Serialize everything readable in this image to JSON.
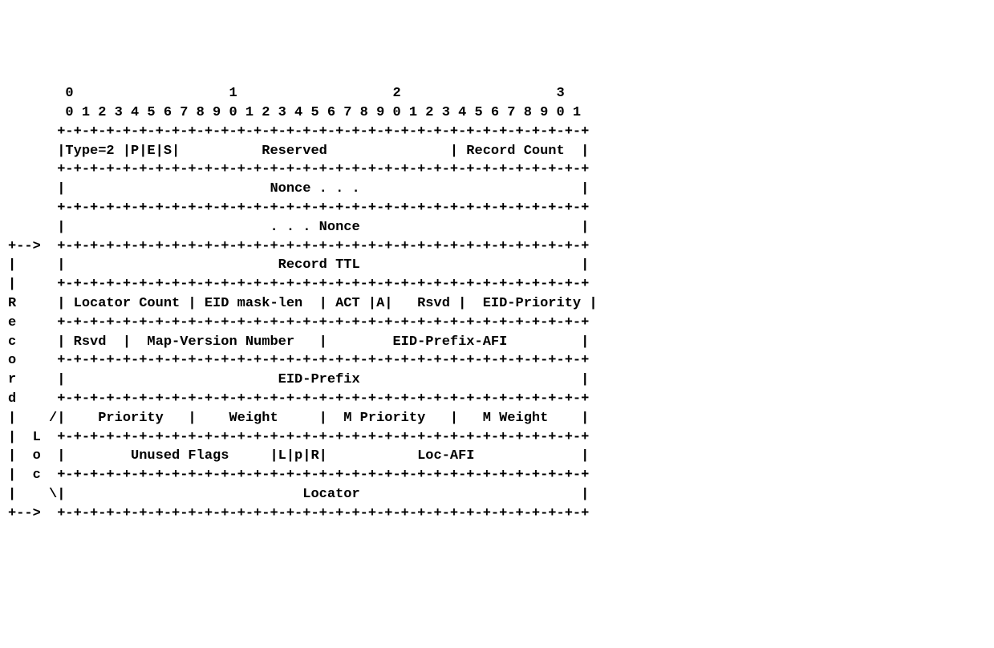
{
  "diagram": {
    "type": "packet-format",
    "bit_ruler_top": "       0                   1                   2                   3",
    "bit_ruler_nums": "       0 1 2 3 4 5 6 7 8 9 0 1 2 3 4 5 6 7 8 9 0 1 2 3 4 5 6 7 8 9 0 1",
    "sep": "      +-+-+-+-+-+-+-+-+-+-+-+-+-+-+-+-+-+-+-+-+-+-+-+-+-+-+-+-+-+-+-+-+",
    "row_header": "      |Type=2 |P|E|S|          Reserved               | Record Count  |",
    "row_nonce1": "      |                         Nonce . . .                           |",
    "row_nonce2": "      |                         . . . Nonce                           |",
    "arrow_sep": "+-->  +-+-+-+-+-+-+-+-+-+-+-+-+-+-+-+-+-+-+-+-+-+-+-+-+-+-+-+-+-+-+-+-+",
    "row_ttl": "|     |                          Record TTL                           |",
    "sep_pipe": "|     +-+-+-+-+-+-+-+-+-+-+-+-+-+-+-+-+-+-+-+-+-+-+-+-+-+-+-+-+-+-+-+-+",
    "row_loccount": "R     | Locator Count | EID mask-len  | ACT |A|   Rsvd |  EID-Priority |",
    "sep_e": "e     +-+-+-+-+-+-+-+-+-+-+-+-+-+-+-+-+-+-+-+-+-+-+-+-+-+-+-+-+-+-+-+-+",
    "row_mapver": "c     | Rsvd  |  Map-Version Number   |        EID-Prefix-AFI         |",
    "sep_o": "o     +-+-+-+-+-+-+-+-+-+-+-+-+-+-+-+-+-+-+-+-+-+-+-+-+-+-+-+-+-+-+-+-+",
    "row_eidprefix": "r     |                          EID-Prefix                           |",
    "sep_d": "d     +-+-+-+-+-+-+-+-+-+-+-+-+-+-+-+-+-+-+-+-+-+-+-+-+-+-+-+-+-+-+-+-+",
    "row_priority": "|    /|    Priority   |    Weight     |  M Priority   |   M Weight    |",
    "sep_L": "|  L  +-+-+-+-+-+-+-+-+-+-+-+-+-+-+-+-+-+-+-+-+-+-+-+-+-+-+-+-+-+-+-+-+",
    "row_flags": "|  o  |        Unused Flags     |L|p|R|           Loc-AFI             |",
    "sep_c": "|  c  +-+-+-+-+-+-+-+-+-+-+-+-+-+-+-+-+-+-+-+-+-+-+-+-+-+-+-+-+-+-+-+-+",
    "row_locator": "|    \\|                             Locator                           |",
    "fields": {
      "type_value": 2,
      "flags_header": [
        "P",
        "E",
        "S"
      ],
      "reserved": "Reserved",
      "record_count": "Record Count",
      "nonce": "Nonce",
      "record_ttl": "Record TTL",
      "locator_count": "Locator Count",
      "eid_mask_len": "EID mask-len",
      "act": "ACT",
      "a_flag": "A",
      "rsvd": "Rsvd",
      "eid_priority": "EID-Priority",
      "map_version_number": "Map-Version Number",
      "eid_prefix_afi": "EID-Prefix-AFI",
      "eid_prefix": "EID-Prefix",
      "priority": "Priority",
      "weight": "Weight",
      "m_priority": "M Priority",
      "m_weight": "M Weight",
      "unused_flags": "Unused Flags",
      "locator_flags": [
        "L",
        "p",
        "R"
      ],
      "loc_afi": "Loc-AFI",
      "locator": "Locator",
      "vertical_labels": {
        "record": [
          "R",
          "e",
          "c",
          "o",
          "r",
          "d"
        ],
        "loc": [
          "L",
          "o",
          "c"
        ]
      }
    }
  }
}
